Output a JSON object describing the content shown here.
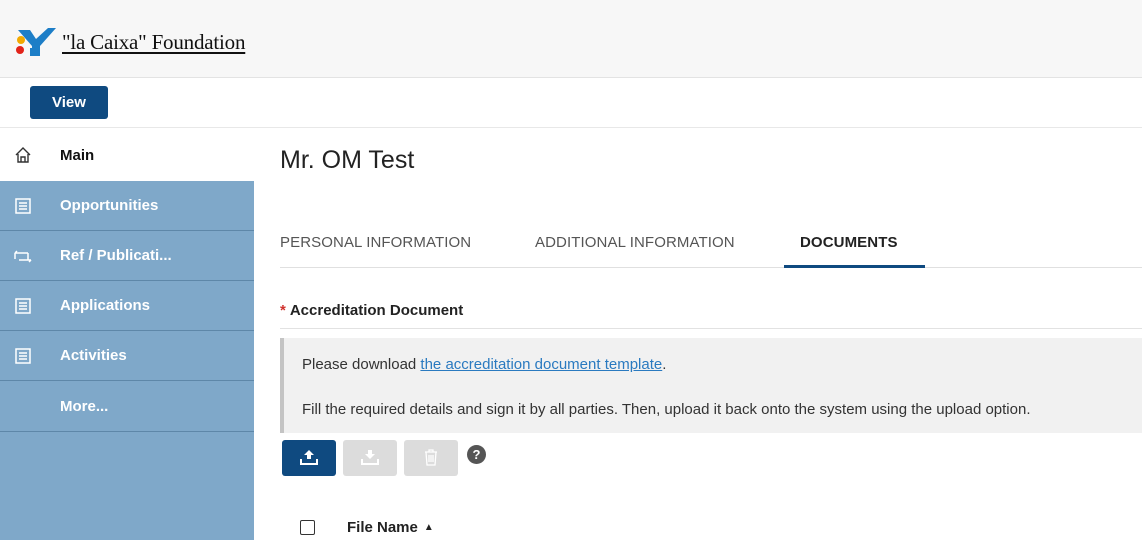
{
  "header": {
    "logo_text": "\"la Caixa\" Foundation",
    "view_button": "View"
  },
  "sidebar": {
    "items": [
      {
        "label": "Main",
        "icon": "home-icon"
      },
      {
        "label": "Opportunities",
        "icon": "list-icon"
      },
      {
        "label": "Ref / Publicati...",
        "icon": "ref-icon"
      },
      {
        "label": "Applications",
        "icon": "list-icon"
      },
      {
        "label": "Activities",
        "icon": "list-icon"
      },
      {
        "label": "More...",
        "icon": ""
      }
    ]
  },
  "main": {
    "title": "Mr. OM Test",
    "tabs": [
      {
        "label": "PERSONAL INFORMATION",
        "active": false
      },
      {
        "label": "ADDITIONAL INFORMATION",
        "active": false
      },
      {
        "label": "DOCUMENTS",
        "active": true
      }
    ],
    "section": {
      "required_marker": "*",
      "label": "Accreditation Document"
    },
    "notice": {
      "line1_prefix": "Please download ",
      "line1_link": "the accreditation document template",
      "line1_suffix": ".",
      "line2": "Fill the required details and sign it by all parties. Then, upload it back onto the system using the upload option."
    },
    "toolbar": {
      "upload": "upload-icon",
      "download": "download-icon",
      "delete": "trash-icon",
      "help": "?"
    },
    "table": {
      "columns": [
        {
          "label": "File Name",
          "sort": "ascending"
        }
      ]
    }
  },
  "colors": {
    "primary": "#0f4a80",
    "sidebar": "#7fa8c9",
    "link": "#2a7ac0",
    "required": "#d0312d"
  }
}
